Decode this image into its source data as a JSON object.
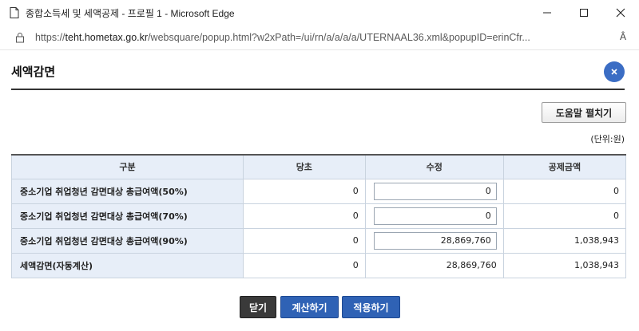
{
  "window": {
    "title": "종합소득세 및 세액공제 - 프로필 1 - Microsoft Edge",
    "controls": {
      "minimize": "—",
      "maximize": "☐",
      "close": "✕"
    }
  },
  "address": {
    "prefix": "https://",
    "domain": "teht.hometax.go.kr",
    "path": "/websquare/popup.html?w2xPath=/ui/rn/a/a/a/a/UTERNAAL36.xml&popupID=erinCfr...",
    "reader_icon_text": "Â"
  },
  "popup": {
    "title": "세액감면",
    "help_button": "도움말 펼치기",
    "unit": "(단위:원)"
  },
  "table": {
    "headers": [
      "구분",
      "당초",
      "수정",
      "공제금액"
    ],
    "rows": [
      {
        "label": "중소기업 취업청년 감면대상 총급여액(50%)",
        "original": "0",
        "modified": "0",
        "deduction": "0"
      },
      {
        "label": "중소기업 취업청년 감면대상 총급여액(70%)",
        "original": "0",
        "modified": "0",
        "deduction": "0"
      },
      {
        "label": "중소기업 취업청년 감면대상 총급여액(90%)",
        "original": "0",
        "modified": "28,869,760",
        "deduction": "1,038,943"
      },
      {
        "label": "세액감면(자동계산)",
        "original": "0",
        "modified": "28,869,760",
        "deduction": "1,038,943"
      }
    ]
  },
  "buttons": {
    "close": "닫기",
    "calculate": "계산하기",
    "apply": "적용하기"
  },
  "colors": {
    "accent": "#2f62b5",
    "header_bg": "#e7eef8",
    "dark_button": "#3a3a3a"
  }
}
